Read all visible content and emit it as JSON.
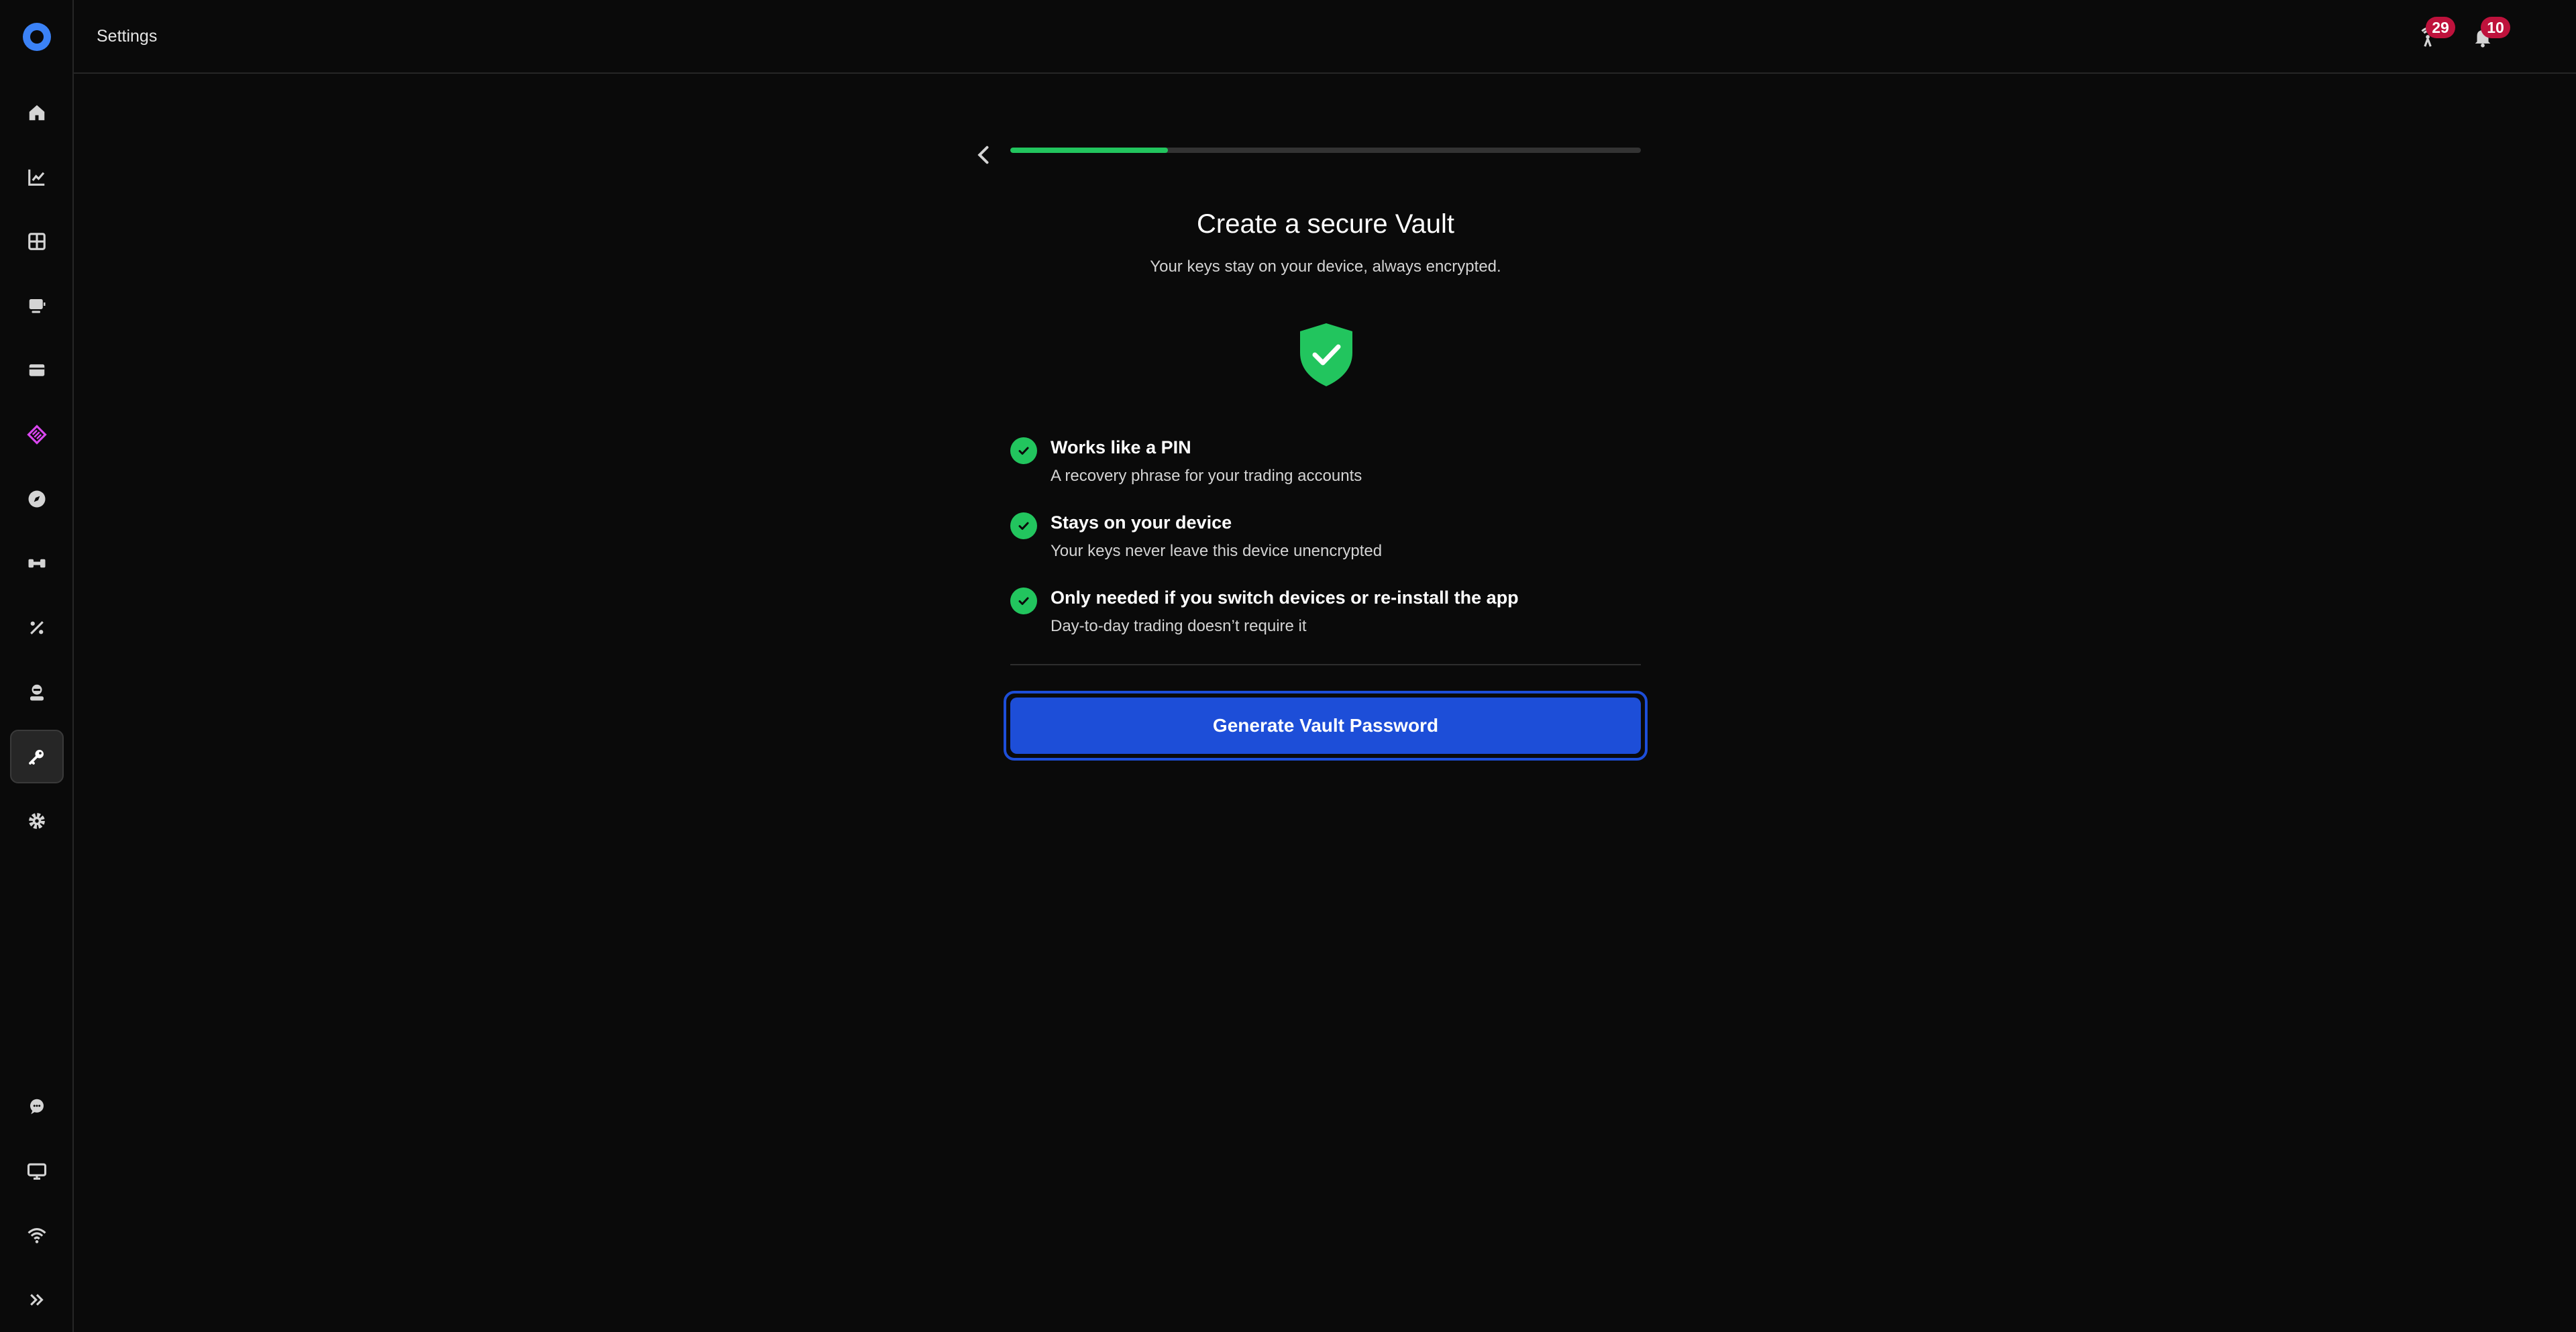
{
  "app": {
    "page_title": "Settings",
    "accent_color": "#1d4ed8",
    "success_color": "#22c55e"
  },
  "topbar": {
    "alerts_badge": "29",
    "notifications_badge": "10"
  },
  "sidebar": {
    "items": [
      {
        "name": "home",
        "icon": "home-icon"
      },
      {
        "name": "analytics",
        "icon": "chart-icon"
      },
      {
        "name": "dashboard",
        "icon": "grid-icon"
      },
      {
        "name": "terminal",
        "icon": "monitor-icon"
      },
      {
        "name": "wallet",
        "icon": "wallet-icon"
      },
      {
        "name": "rewards",
        "icon": "diamond-icon"
      },
      {
        "name": "explore",
        "icon": "compass-icon"
      },
      {
        "name": "integrations",
        "icon": "puzzle-icon"
      },
      {
        "name": "fees",
        "icon": "percent-icon"
      },
      {
        "name": "account",
        "icon": "user-icon"
      },
      {
        "name": "vault",
        "icon": "key-icon",
        "active": true
      },
      {
        "name": "settings",
        "icon": "gear-icon"
      }
    ],
    "bottom_items": [
      {
        "name": "support",
        "icon": "chat-icon"
      },
      {
        "name": "display",
        "icon": "desktop-icon"
      },
      {
        "name": "connection",
        "icon": "wifi-icon"
      },
      {
        "name": "expand",
        "icon": "chevrons-right-icon"
      }
    ]
  },
  "vault": {
    "progress": 0.25,
    "title": "Create a secure Vault",
    "subtitle": "Your keys stay on your device, always encrypted.",
    "features": [
      {
        "title": "Works like a PIN",
        "description": "A recovery phrase for your trading accounts"
      },
      {
        "title": "Stays on your device",
        "description": "Your keys never leave this device unencrypted"
      },
      {
        "title": "Only needed if you switch devices or re-install the app",
        "description": "Day-to-day trading doesn’t require it"
      }
    ],
    "button_label": "Generate Vault Password"
  }
}
